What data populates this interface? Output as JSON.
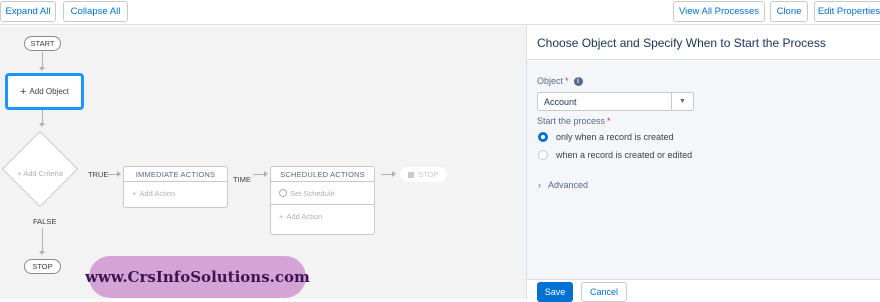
{
  "toolbar": {
    "expand_all": "Expand All",
    "collapse_all": "Collapse All",
    "view_all_processes": "View All Processes",
    "clone": "Clone",
    "edit_properties": "Edit Properties"
  },
  "canvas": {
    "start_label": "START",
    "add_object_label": "Add Object",
    "add_criteria_label": "Add Criteria",
    "true_label": "TRUE",
    "false_label": "FALSE",
    "time_label": "TIME",
    "immediate_actions": {
      "header": "IMMEDIATE ACTIONS",
      "add_action": "Add Action"
    },
    "scheduled_actions": {
      "header": "SCHEDULED ACTIONS",
      "set_schedule": "Set Schedule",
      "add_action": "Add Action"
    },
    "stop_node_label": "STOP",
    "stop_label": "STOP"
  },
  "watermark": "www.CrsInfoSolutions.com",
  "panel": {
    "title": "Choose Object and Specify When to Start the Process",
    "object_label": "Object",
    "object_value": "Account",
    "start_process_label": "Start the process",
    "options": [
      {
        "label": "only when a record is created",
        "selected": true
      },
      {
        "label": "when a record is created or edited",
        "selected": false
      }
    ],
    "advanced_label": "Advanced",
    "save_label": "Save",
    "cancel_label": "Cancel"
  },
  "colors": {
    "accent": "#0070d2",
    "selected_node_border": "#1b96ff",
    "watermark_bg": "#d4a4d6"
  },
  "icons": [
    "plus-icon",
    "info-icon",
    "clock-icon",
    "chevron-down-icon",
    "chevron-right-icon",
    "stop-square-icon"
  ]
}
